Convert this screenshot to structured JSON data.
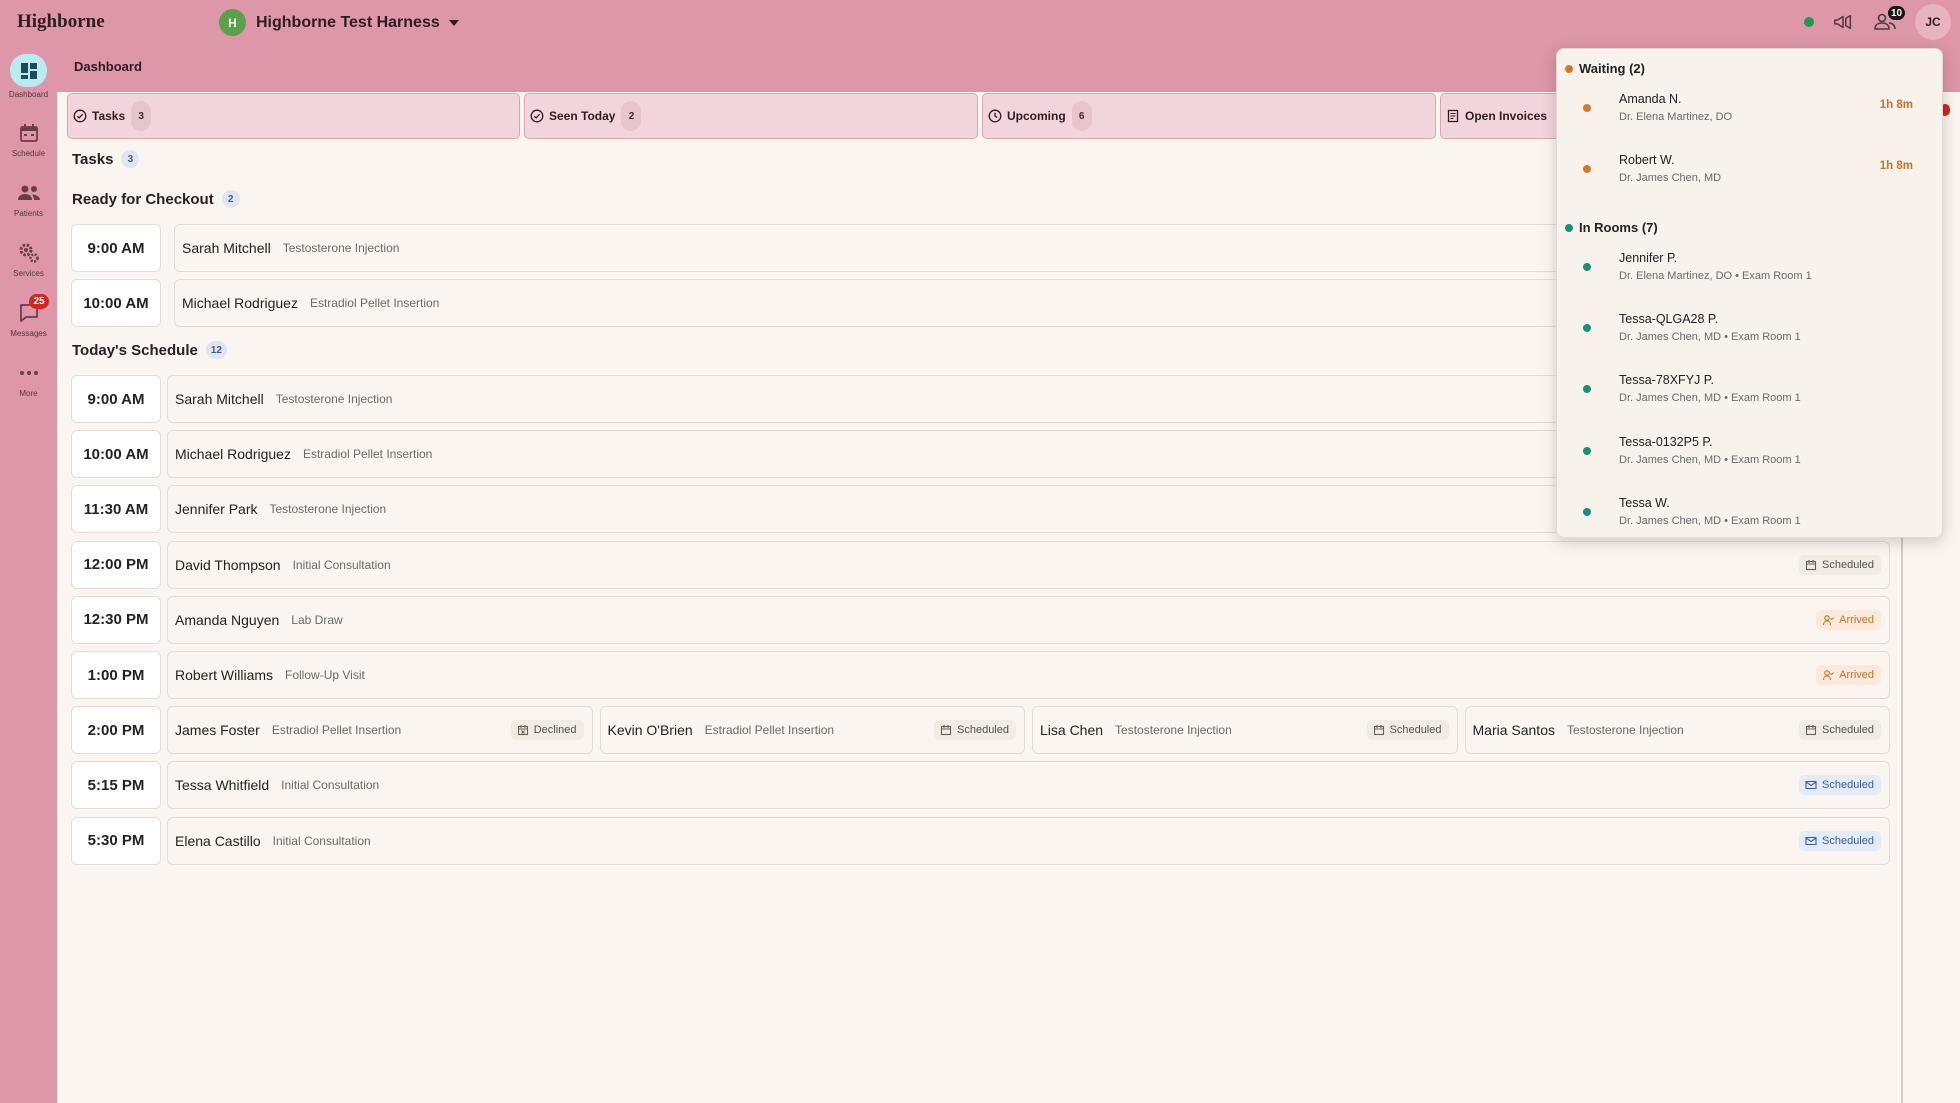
{
  "app": {
    "logo": "Highborne",
    "org_initial": "H",
    "org_name": "Highborne Test Harness",
    "user_initials": "JC",
    "people_count": "10"
  },
  "colors": {
    "accent": "#dd97a8",
    "active_nav": "#b8ecf0",
    "arrived": "#c7731f",
    "scheduled_blue": "#3c5f9a",
    "online": "#1f9a4a"
  },
  "sidebar": {
    "items": [
      {
        "label": "Dashboard",
        "icon": "dashboard-icon",
        "active": true
      },
      {
        "label": "Schedule",
        "icon": "calendar-icon"
      },
      {
        "label": "Patients",
        "icon": "people-icon"
      },
      {
        "label": "Services",
        "icon": "gears-icon"
      },
      {
        "label": "Messages",
        "icon": "chat-icon",
        "badge": "25"
      },
      {
        "label": "More",
        "icon": "more-icon"
      }
    ]
  },
  "page": {
    "title": "Dashboard"
  },
  "stats": [
    {
      "label": "Tasks",
      "count": "3",
      "icon": "check-circle-icon"
    },
    {
      "label": "Seen Today",
      "count": "2",
      "icon": "check-circle-icon"
    },
    {
      "label": "Upcoming",
      "count": "6",
      "icon": "clock-icon"
    },
    {
      "label": "Open Invoices",
      "count": "",
      "icon": "invoice-icon"
    }
  ],
  "tasks": {
    "title": "Tasks",
    "count": "3"
  },
  "checkout": {
    "title": "Ready for Checkout",
    "count": "2",
    "rows": [
      {
        "time": "9:00 AM",
        "name": "Sarah Mitchell",
        "service": "Testosterone Injection"
      },
      {
        "time": "10:00 AM",
        "name": "Michael Rodriguez",
        "service": "Estradiol Pellet Insertion"
      }
    ]
  },
  "schedule": {
    "title": "Today's Schedule",
    "count": "12",
    "rows": [
      {
        "time": "9:00 AM",
        "appts": [
          {
            "name": "Sarah Mitchell",
            "service": "Testosterone Injection"
          }
        ]
      },
      {
        "time": "10:00 AM",
        "appts": [
          {
            "name": "Michael Rodriguez",
            "service": "Estradiol Pellet Insertion"
          }
        ]
      },
      {
        "time": "11:30 AM",
        "appts": [
          {
            "name": "Jennifer Park",
            "service": "Testosterone Injection"
          }
        ]
      },
      {
        "time": "12:00 PM",
        "appts": [
          {
            "name": "David Thompson",
            "service": "Initial Consultation",
            "status": "Scheduled",
            "style": "scheduled"
          }
        ]
      },
      {
        "time": "12:30 PM",
        "appts": [
          {
            "name": "Amanda Nguyen",
            "service": "Lab Draw",
            "status": "Arrived",
            "style": "arrived"
          }
        ]
      },
      {
        "time": "1:00 PM",
        "appts": [
          {
            "name": "Robert Williams",
            "service": "Follow-Up Visit",
            "status": "Arrived",
            "style": "arrived"
          }
        ]
      },
      {
        "time": "2:00 PM",
        "appts": [
          {
            "name": "James Foster",
            "service": "Estradiol Pellet Insertion",
            "status": "Declined",
            "style": "declined"
          },
          {
            "name": "Kevin O'Brien",
            "service": "Estradiol Pellet Insertion",
            "status": "Scheduled",
            "style": "scheduled"
          },
          {
            "name": "Lisa Chen",
            "service": "Testosterone Injection",
            "status": "Scheduled",
            "style": "scheduled"
          },
          {
            "name": "Maria Santos",
            "service": "Testosterone Injection",
            "status": "Scheduled",
            "style": "scheduled"
          }
        ]
      },
      {
        "time": "5:15 PM",
        "appts": [
          {
            "name": "Tessa Whitfield",
            "service": "Initial Consultation",
            "status": "Scheduled",
            "style": "sched-blue"
          }
        ]
      },
      {
        "time": "5:30 PM",
        "appts": [
          {
            "name": "Elena Castillo",
            "service": "Initial Consultation",
            "status": "Scheduled",
            "style": "sched-blue"
          }
        ]
      }
    ]
  },
  "popover": {
    "waiting_title": "Waiting (2)",
    "waiting": [
      {
        "name": "Amanda N.",
        "provider": "Dr. Elena Martinez, DO",
        "wait": "1h 8m"
      },
      {
        "name": "Robert W.",
        "provider": "Dr. James Chen, MD",
        "wait": "1h 8m"
      }
    ],
    "rooms_title": "In Rooms (7)",
    "rooms": [
      {
        "name": "Jennifer P.",
        "detail": "Dr. Elena Martinez, DO • Exam Room 1"
      },
      {
        "name": "Tessa-QLGA28 P.",
        "detail": "Dr. James Chen, MD • Exam Room 1"
      },
      {
        "name": "Tessa-78XFYJ P.",
        "detail": "Dr. James Chen, MD • Exam Room 1"
      },
      {
        "name": "Tessa-0132P5 P.",
        "detail": "Dr. James Chen, MD • Exam Room 1"
      },
      {
        "name": "Tessa W.",
        "detail": "Dr. James Chen, MD • Exam Room 1"
      }
    ]
  }
}
